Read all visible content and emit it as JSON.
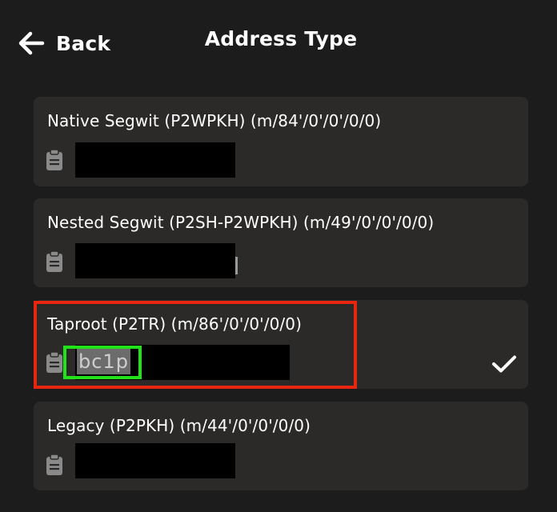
{
  "header": {
    "back_label": "Back",
    "title": "Address Type"
  },
  "address_types": [
    {
      "label": "Native Segwit (P2WPKH) (m/84'/0'/0'/0/0)",
      "address_prefix": "",
      "selected": false
    },
    {
      "label": "Nested Segwit (P2SH-P2WPKH) (m/49'/0'/0'/0/0)",
      "address_prefix": "",
      "selected": false
    },
    {
      "label": "Taproot (P2TR) (m/86'/0'/0'/0/0)",
      "address_prefix": "bc1p",
      "selected": true
    },
    {
      "label": "Legacy (P2PKH) (m/44'/0'/0'/0/0)",
      "address_prefix": "",
      "selected": false
    }
  ],
  "icons": {
    "back": "arrow-left-icon",
    "copy": "clipboard-icon",
    "selected": "checkmark-icon"
  },
  "colors": {
    "background": "#1c1c1c",
    "card": "#2b2a29",
    "text": "#ffffff",
    "redacted": "#000000",
    "highlight_red": "#e8250f",
    "highlight_green": "#22e21a"
  }
}
